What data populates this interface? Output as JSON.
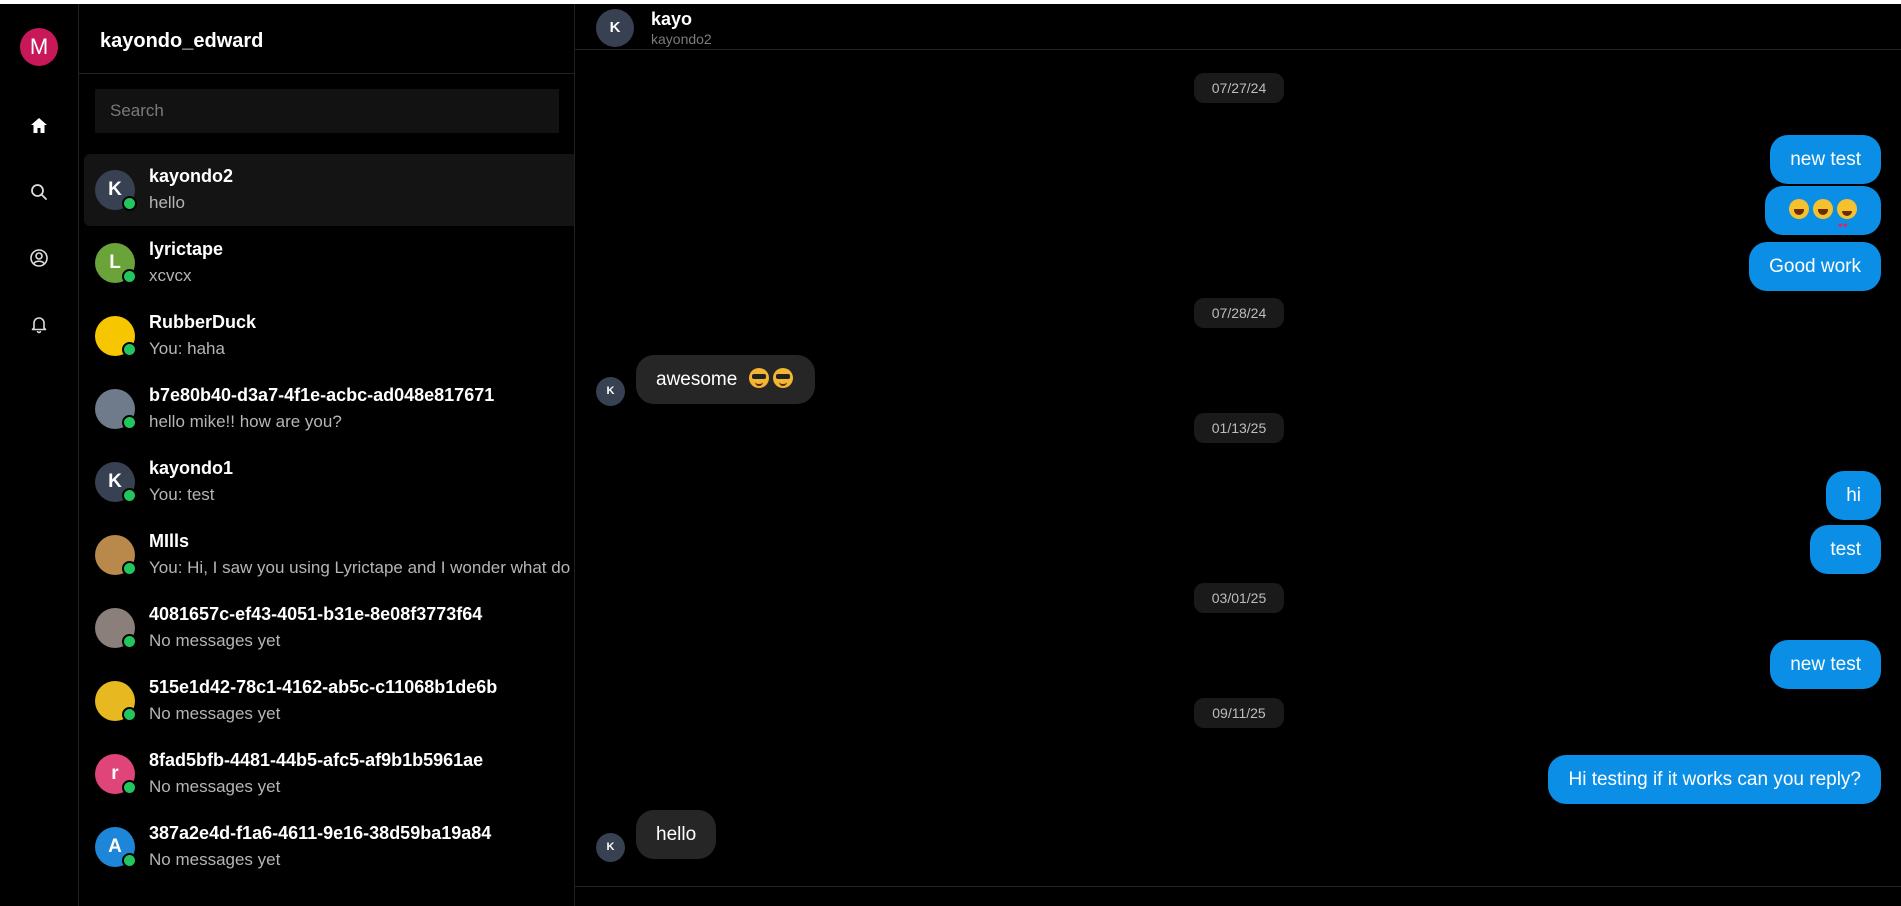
{
  "rail": {
    "me_initial": "M",
    "icons": [
      "home-icon",
      "search-icon",
      "profile-icon",
      "bell-icon"
    ]
  },
  "sidebar": {
    "username": "kayondo_edward",
    "search_placeholder": "Search",
    "conversations": [
      {
        "name": "kayondo2",
        "preview": "hello",
        "initial": "K",
        "avatar_color": "#374152",
        "active": true
      },
      {
        "name": "lyrictape",
        "preview": "xcvcx",
        "initial": "L",
        "avatar_color": "#6aa33a"
      },
      {
        "name": "RubberDuck",
        "preview": "You: haha",
        "initial": "",
        "avatar_color": "#f6c700"
      },
      {
        "name": "b7e80b40-d3a7-4f1e-acbc-ad048e817671",
        "preview": "hello mike!! how are you?",
        "initial": "",
        "avatar_color": "#6f7a8a"
      },
      {
        "name": "kayondo1",
        "preview": "You: test",
        "initial": "K",
        "avatar_color": "#374152"
      },
      {
        "name": "MIlls",
        "preview": "You: Hi, I saw you using Lyrictape and I wonder what do",
        "initial": "",
        "avatar_color": "#b8894a"
      },
      {
        "name": "4081657c-ef43-4051-b31e-8e08f3773f64",
        "preview": "No messages yet",
        "initial": "",
        "avatar_color": "#8a7f7a"
      },
      {
        "name": "515e1d42-78c1-4162-ab5c-c11068b1de6b",
        "preview": "No messages yet",
        "initial": "",
        "avatar_color": "#e8b820"
      },
      {
        "name": "8fad5bfb-4481-44b5-afc5-af9b1b5961ae",
        "preview": "No messages yet",
        "initial": "r",
        "avatar_color": "#e0457a"
      },
      {
        "name": "387a2e4d-f1a6-4611-9e16-38d59ba19a84",
        "preview": "No messages yet",
        "initial": "A",
        "avatar_color": "#1e86d8"
      }
    ]
  },
  "chat": {
    "contact_initial": "K",
    "contact_name": "kayo",
    "contact_handle": "kayondo2",
    "dates": [
      "07/27/24",
      "07/28/24",
      "01/13/25",
      "03/01/25",
      "09/11/25"
    ],
    "messages": {
      "m1": "new test",
      "m3": "Good work",
      "m4": "awesome",
      "m5": "hi",
      "m6": "test",
      "m7": "new test",
      "m8": "Hi testing if it works can you reply?",
      "m9": "hello"
    },
    "emoji_reactions": [
      "grinning-sweat-emoji",
      "grinning-emoji",
      "heart-eyes-emoji"
    ],
    "incoming_initial": "K"
  },
  "colors": {
    "accent": "#0b8fe6",
    "online": "#22c55e",
    "me_avatar": "#c8185a"
  }
}
